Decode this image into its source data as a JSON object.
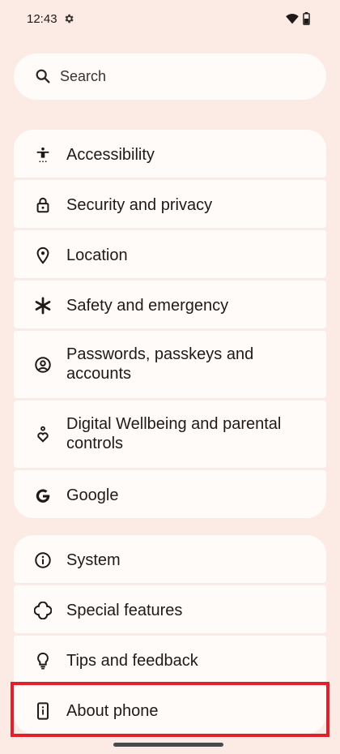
{
  "status_bar": {
    "time": "12:43",
    "icons": [
      "gear-icon",
      "wifi-icon",
      "battery-icon"
    ]
  },
  "search": {
    "placeholder": "Search",
    "icon": "search-icon"
  },
  "groups": [
    {
      "items": [
        {
          "label": "Accessibility",
          "icon": "accessibility-icon"
        },
        {
          "label": "Security and privacy",
          "icon": "lock-icon"
        },
        {
          "label": "Location",
          "icon": "location-pin-icon"
        },
        {
          "label": "Safety and emergency",
          "icon": "asterisk-icon"
        },
        {
          "label": "Passwords, passkeys and accounts",
          "icon": "account-circle-icon"
        },
        {
          "label": "Digital Wellbeing and parental controls",
          "icon": "wellbeing-icon"
        },
        {
          "label": "Google",
          "icon": "google-icon"
        }
      ]
    },
    {
      "items": [
        {
          "label": "System",
          "icon": "info-icon"
        },
        {
          "label": "Special features",
          "icon": "special-features-icon"
        },
        {
          "label": "Tips and feedback",
          "icon": "lightbulb-icon"
        },
        {
          "label": "About phone",
          "icon": "phone-info-icon",
          "highlighted": true
        }
      ]
    }
  ],
  "colors": {
    "background": "#fcebe5",
    "card": "#fffbf9",
    "highlight": "#e0202a"
  }
}
